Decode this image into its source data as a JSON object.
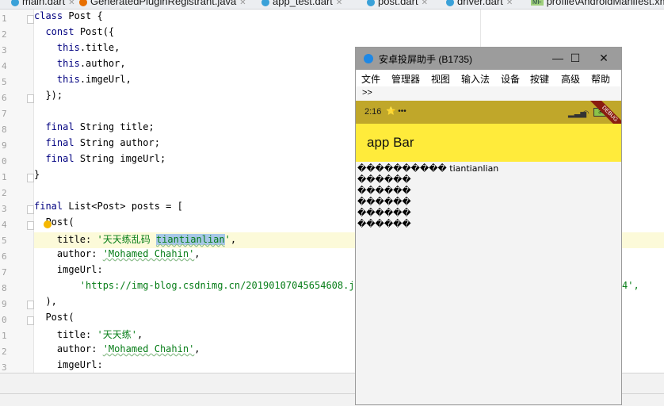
{
  "ide": {
    "tabs": [
      {
        "label": "main.dart",
        "kind": "dart",
        "active": false
      },
      {
        "label": "GeneratedPluginRegistrant.java",
        "kind": "java",
        "active": false
      },
      {
        "label": "app_test.dart",
        "kind": "dart",
        "active": false
      },
      {
        "label": "post.dart",
        "kind": "dart",
        "active": true
      },
      {
        "label": "driver.dart",
        "kind": "dart",
        "active": false
      },
      {
        "label": "profile\\AndroidManifest.xml",
        "kind": "manifest",
        "active": false
      }
    ],
    "manifest_badge": "MF",
    "line_numbers": [
      "1",
      "2",
      "3",
      "4",
      "5",
      "6",
      "7",
      "8",
      "9",
      "0",
      "1",
      "2",
      "3",
      "4",
      "5",
      "6",
      "7",
      "8",
      "9",
      "0",
      "1",
      "2",
      "3"
    ],
    "code_lines": [
      [
        [
          "kw",
          "class "
        ],
        [
          "t",
          "Post {"
        ]
      ],
      [
        [
          "t",
          "  "
        ],
        [
          "kw",
          "const "
        ],
        [
          "t",
          "Post({"
        ]
      ],
      [
        [
          "t",
          "    "
        ],
        [
          "kw",
          "this"
        ],
        [
          "t",
          ".title,"
        ]
      ],
      [
        [
          "t",
          "    "
        ],
        [
          "kw",
          "this"
        ],
        [
          "t",
          ".author,"
        ]
      ],
      [
        [
          "t",
          "    "
        ],
        [
          "kw",
          "this"
        ],
        [
          "t",
          ".imgeUrl,"
        ]
      ],
      [
        [
          "t",
          "  });"
        ]
      ],
      [
        [
          "t",
          ""
        ]
      ],
      [
        [
          "t",
          "  "
        ],
        [
          "kw",
          "final "
        ],
        [
          "t",
          "String title;"
        ]
      ],
      [
        [
          "t",
          "  "
        ],
        [
          "kw",
          "final "
        ],
        [
          "t",
          "String author;"
        ]
      ],
      [
        [
          "t",
          "  "
        ],
        [
          "kw",
          "final "
        ],
        [
          "t",
          "String imgeUrl;"
        ]
      ],
      [
        [
          "t",
          "}"
        ]
      ],
      [
        [
          "t",
          ""
        ]
      ],
      [
        [
          "kw",
          "final "
        ],
        [
          "t",
          "List<Post> posts = ["
        ]
      ],
      [
        [
          "t",
          "  Post("
        ]
      ],
      [
        [
          "t",
          "    title: "
        ],
        [
          "str",
          "'天天练乱码 "
        ],
        [
          "sel",
          "tiantianlian"
        ],
        [
          "str",
          "'"
        ],
        [
          "t",
          ","
        ]
      ],
      [
        [
          "t",
          "    author: "
        ],
        [
          "str",
          "'Mohamed Chahin'"
        ],
        [
          "t",
          ","
        ]
      ],
      [
        [
          "t",
          "    imgeUrl:"
        ]
      ],
      [
        [
          "t",
          "        "
        ],
        [
          "str",
          "'https://img-blog.csdnimg.cn/20190107045654608.jpeg"
        ]
      ],
      [
        [
          "t",
          "  ),"
        ]
      ],
      [
        [
          "t",
          "  Post("
        ]
      ],
      [
        [
          "t",
          "    title: "
        ],
        [
          "str",
          "'天天练'"
        ],
        [
          "t",
          ","
        ]
      ],
      [
        [
          "t",
          "    author: "
        ],
        [
          "str",
          "'Mohamed Chahin'"
        ],
        [
          "t",
          ","
        ]
      ],
      [
        [
          "t",
          "    imgeUrl:"
        ]
      ]
    ],
    "overflow_text": "4',"
  },
  "emulator": {
    "title": "安卓投屏助手 (B1735)",
    "controls": {
      "minimize": "—",
      "maximize": "☐",
      "close": "✕"
    },
    "menu": [
      "文件",
      "管理器",
      "视图",
      "输入法",
      "设备",
      "按键",
      "高级",
      "帮助"
    ],
    "more": ">>",
    "phone": {
      "time": "2:16",
      "status_extra": "⭐ •••",
      "battery": "30",
      "debug_banner": "DEBUG",
      "app_bar_title": "app Bar",
      "list_items": [
        "���������� tiantianlian",
        "������",
        "������",
        "������",
        "������",
        "������"
      ]
    }
  }
}
